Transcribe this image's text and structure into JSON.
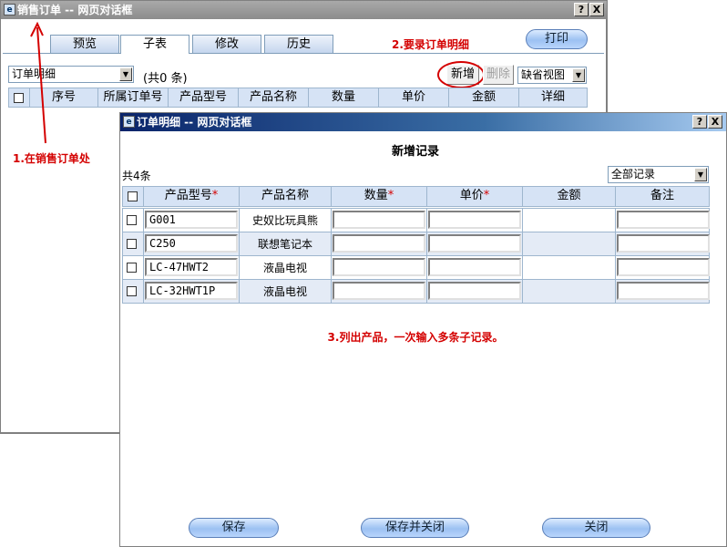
{
  "main_window": {
    "title": "销售订单 -- 网页对话框",
    "help_btn": "?",
    "close_btn": "X",
    "tabs": [
      "预览",
      "子表",
      "修改",
      "历史"
    ],
    "print_btn": "打印",
    "subtable_select": "订单明细",
    "count": "(共0 条)",
    "add_btn": "新增",
    "delete_btn": "删除",
    "view_select": "缺省视图",
    "columns": [
      "序号",
      "所属订单号",
      "产品型号",
      "产品名称",
      "数量",
      "单价",
      "金额",
      "详细"
    ]
  },
  "annotations": {
    "step1": "1.在销售订单处",
    "step2": "2.要录订单明细",
    "step3": "3.列出产品，一次输入多条子记录。"
  },
  "dialog": {
    "title": "订单明细 -- 网页对话框",
    "help_btn": "?",
    "close_btn": "X",
    "heading": "新增记录",
    "count": "共4条",
    "filter_select": "全部记录",
    "columns": [
      "产品型号",
      "产品名称",
      "数量",
      "单价",
      "金额",
      "备注"
    ],
    "required_mark": "*",
    "rows": [
      {
        "model": "G001",
        "name": "史奴比玩具熊"
      },
      {
        "model": "C250",
        "name": "联想笔记本"
      },
      {
        "model": "LC-47HWT2",
        "name": "液晶电视"
      },
      {
        "model": "LC-32HWT1P",
        "name": "液晶电视"
      }
    ],
    "buttons": {
      "save": "保存",
      "save_close": "保存并关闭",
      "close": "关闭"
    }
  },
  "colors": {
    "annotation": "#d40000",
    "header_bg": "#d6e3f5",
    "row_alt": "#e4ebf6"
  }
}
